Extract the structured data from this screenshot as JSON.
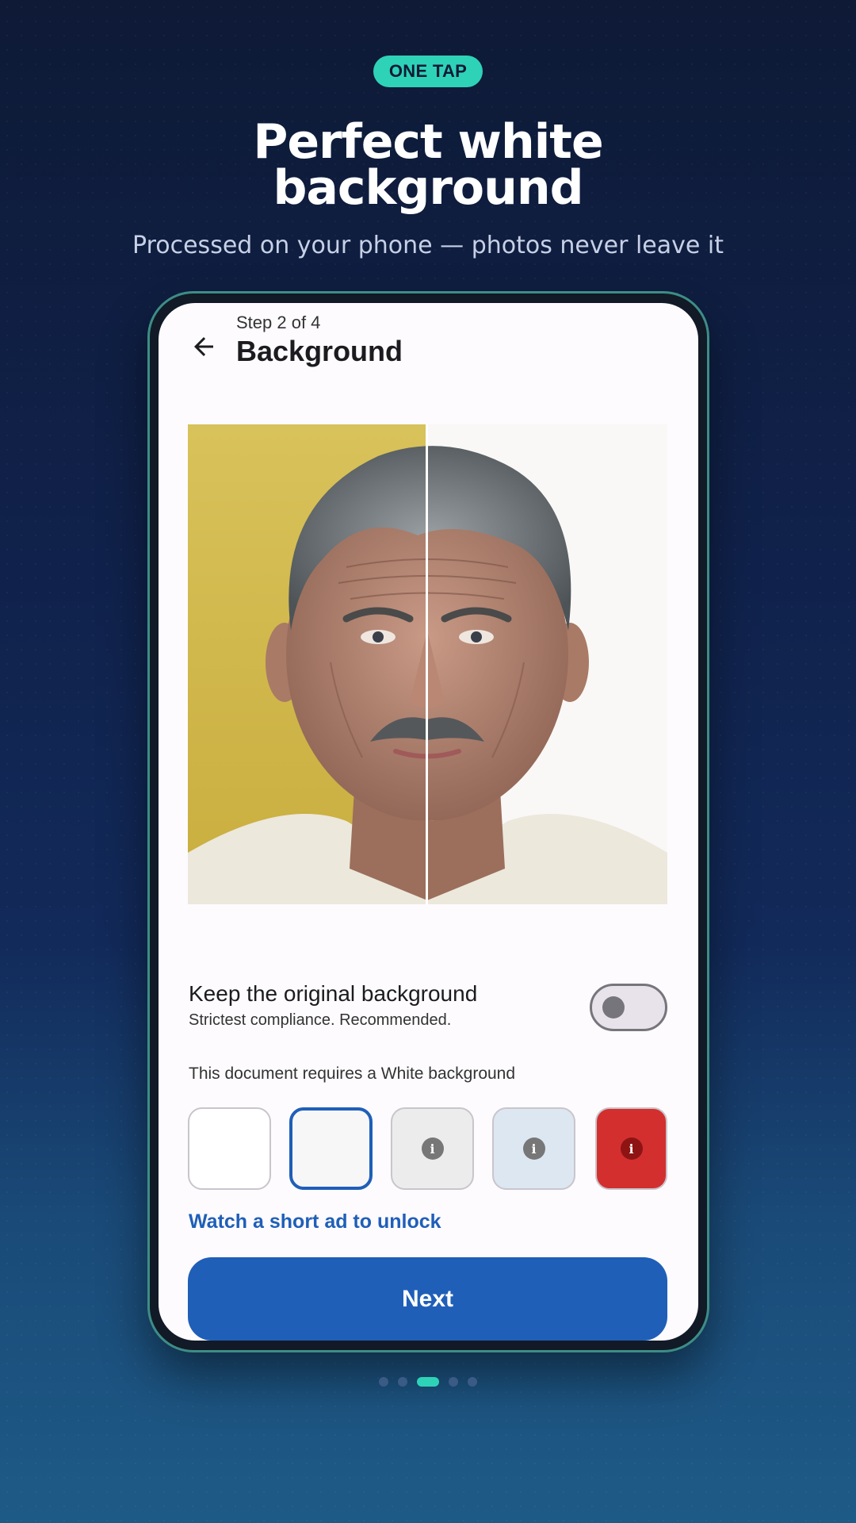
{
  "banner": {
    "badge": "ONE TAP",
    "headline_line1": "Perfect white",
    "headline_line2": "background",
    "subline": "Processed on your phone — photos never leave it"
  },
  "screen": {
    "step": "Step 2 of 4",
    "title": "Background",
    "keep_original": {
      "title": "Keep the original background",
      "subtitle": "Strictest compliance. Recommended.",
      "enabled": false
    },
    "requirement_text": "This document requires a White background",
    "swatches": [
      {
        "name": "white",
        "color": "#ffffff",
        "locked": false,
        "selected": false
      },
      {
        "name": "off-white",
        "color": "#f8f7f8",
        "locked": false,
        "selected": true
      },
      {
        "name": "light-gray",
        "color": "#ececec",
        "locked": true,
        "selected": false
      },
      {
        "name": "light-blue",
        "color": "#dce7f2",
        "locked": true,
        "selected": false
      },
      {
        "name": "red",
        "color": "#d32f2f",
        "locked": true,
        "selected": false
      }
    ],
    "unlock_link": "Watch a short ad to unlock",
    "next_button": "Next"
  },
  "pager": {
    "count": 5,
    "active": 2
  },
  "colors": {
    "accent": "#2ed3b7",
    "primary": "#1f5fb8"
  },
  "icons": {
    "back": "arrow-left-icon",
    "info": "info-icon"
  }
}
